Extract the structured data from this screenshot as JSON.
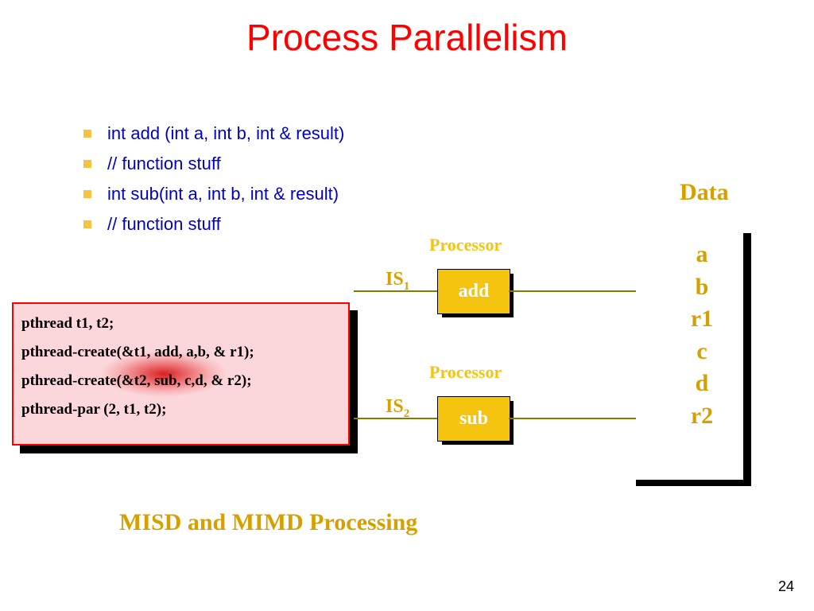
{
  "title": "Process Parallelism",
  "bullets": [
    "int add (int a, int b, int & result)",
    "// function stuff",
    "int sub(int a, int b, int & result)",
    "// function stuff"
  ],
  "code": {
    "l1": "pthread t1, t2;",
    "l2": "pthread-create(&t1, add, a,b, & r1);",
    "l3": "pthread-create(&t2, sub, c,d, & r2);",
    "l4": "pthread-par (2, t1, t2);"
  },
  "is1": "IS",
  "is1_sub": "1",
  "is2": "IS",
  "is2_sub": "2",
  "proc_label": "Processor",
  "proc1_name": "add",
  "proc2_name": "sub",
  "data_title": "Data",
  "data_items": {
    "d1": "a",
    "d2": "b",
    "d3": "r1",
    "d4": "c",
    "d5": "d",
    "d6": "r2"
  },
  "caption": "MISD and MIMD Processing",
  "page": "24"
}
